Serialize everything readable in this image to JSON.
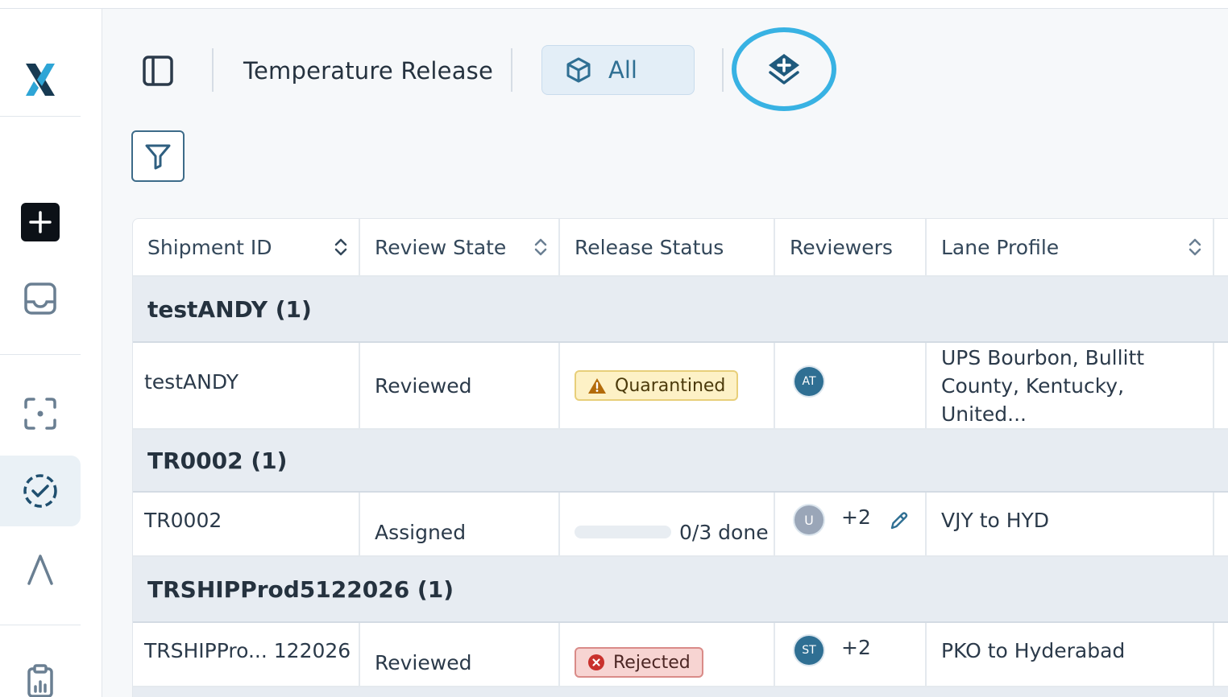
{
  "app": {
    "logo": "X",
    "page_title": "Temperature Release",
    "view_filter_label": "All"
  },
  "sidebar": {
    "items": [
      {
        "name": "new-item",
        "icon": "plus-icon"
      },
      {
        "name": "inbox",
        "icon": "inbox-icon"
      },
      {
        "name": "scan",
        "icon": "scan-icon"
      },
      {
        "name": "releases",
        "icon": "dashed-check-circle-icon",
        "active": true
      },
      {
        "name": "lane",
        "icon": "lambda-icon"
      },
      {
        "name": "reports",
        "icon": "clipboard-chart-icon"
      }
    ]
  },
  "table": {
    "columns": [
      {
        "label": "Shipment ID",
        "sortable": true
      },
      {
        "label": "Review State",
        "sortable": true
      },
      {
        "label": "Release Status",
        "sortable": false
      },
      {
        "label": "Reviewers",
        "sortable": false
      },
      {
        "label": "Lane Profile",
        "sortable": true
      }
    ],
    "groups": [
      {
        "label": "testANDY (1)",
        "rows": [
          {
            "shipment_id": "testANDY",
            "review_state": "Reviewed",
            "release_status": {
              "type": "badge",
              "kind": "warning",
              "label": "Quarantined"
            },
            "reviewers": {
              "initials": "AT",
              "more": ""
            },
            "lane_profile_line1": "UPS Bourbon, Bullitt",
            "lane_profile_line2": "County, Kentucky, United..."
          }
        ]
      },
      {
        "label": "TR0002 (1)",
        "rows": [
          {
            "shipment_id": "TR0002",
            "review_state": "Assigned",
            "release_status": {
              "type": "progress",
              "label": "0/3 done",
              "progress": 0
            },
            "reviewers": {
              "initials": "U",
              "more": "+2"
            },
            "lane_profile_line1": "VJY to HYD"
          }
        ]
      },
      {
        "label": "TRSHIPProd5122026 (1)",
        "rows": [
          {
            "shipment_id": "TRSHIPPro... 122026",
            "review_state": "Reviewed",
            "release_status": {
              "type": "badge",
              "kind": "rejected",
              "label": "Rejected"
            },
            "reviewers": {
              "initials": "ST",
              "more": "+2"
            },
            "lane_profile_line1": "PKO to Hyderabad"
          }
        ]
      }
    ]
  },
  "colors": {
    "accent": "#2f6f93",
    "highlight_ring": "#38b2e3",
    "warning_bg": "#fdf1c6",
    "rejected_bg": "#f7d4d2"
  }
}
